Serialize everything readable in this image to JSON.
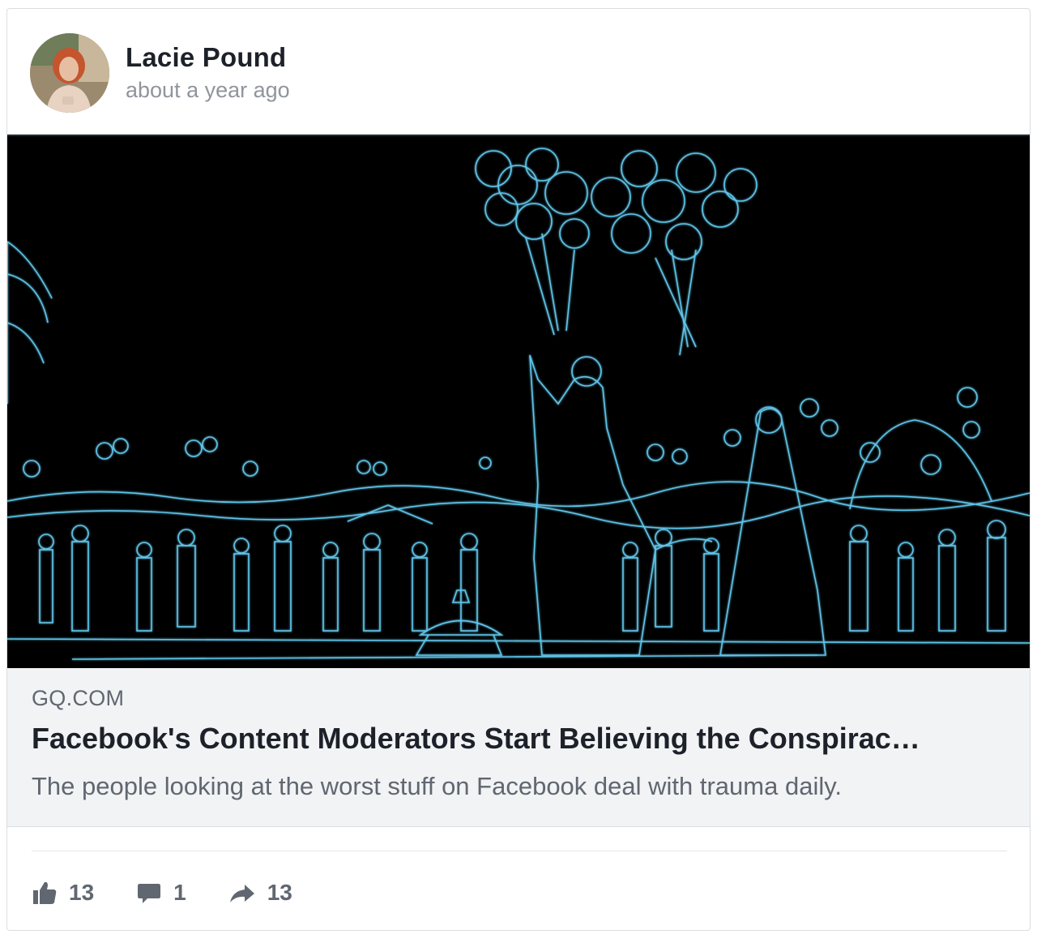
{
  "post": {
    "author": "Lacie Pound",
    "timestamp": "about a year ago",
    "avatar_icon": "profile-photo"
  },
  "link": {
    "domain": "GQ.COM",
    "title": "Facebook's Content Moderators Start Believing the Conspirac…",
    "description": "The people looking at the worst stuff on Facebook deal with trauma daily.",
    "image_description_icon": "wedding-balloons-photo"
  },
  "actions": {
    "likes": "13",
    "comments": "1",
    "shares": "13",
    "like_icon": "thumbs-up-icon",
    "comment_icon": "comment-icon",
    "share_icon": "share-arrow-icon"
  },
  "colors": {
    "name": "#1d2129",
    "secondary": "#90949c",
    "link_bg": "#f2f3f5",
    "glow": "#5fc4e8",
    "action": "#606770"
  }
}
